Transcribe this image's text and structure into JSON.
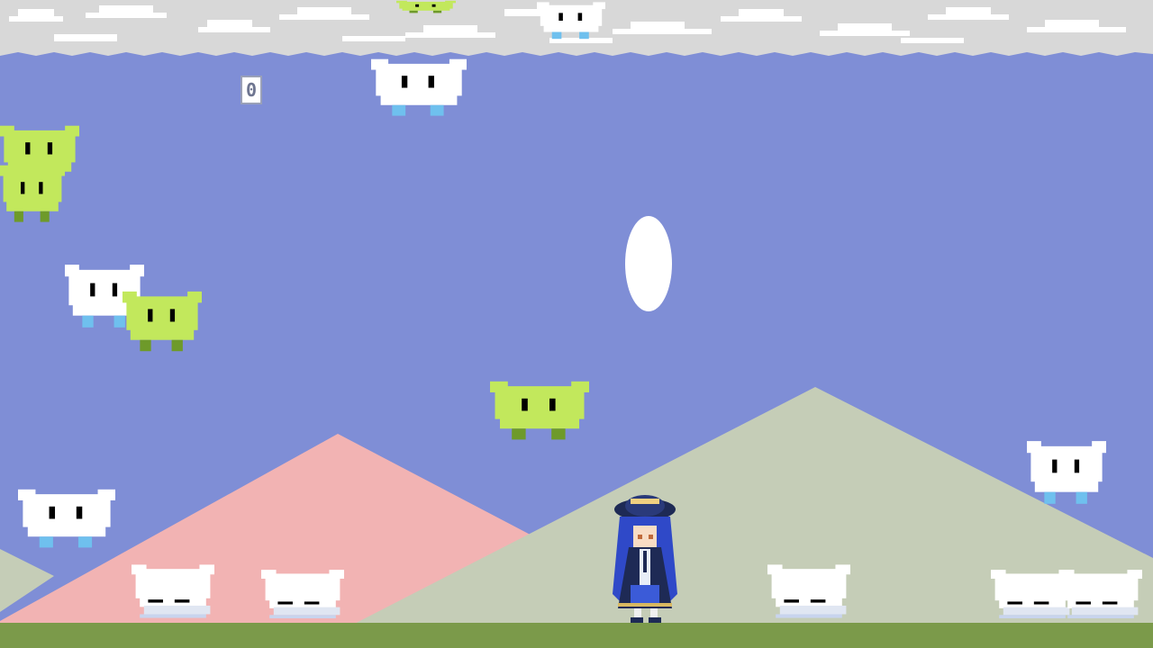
{
  "hud": {
    "score": "0"
  },
  "colors": {
    "sky": "#7f8ed6",
    "cloud_band": "#d8d8d8",
    "cloud": "#ffffff",
    "mountain_pink": "#f2b3b3",
    "mountain_sage": "#c5cdb7",
    "ground": "#7b9a4a",
    "blob_white": "#ffffff",
    "blob_green": "#c2e85c",
    "feet_white": "#6fc0ee",
    "feet_green": "#6e9a2a",
    "eye": "#000000",
    "character_hair": "#2f49c8",
    "character_coat": "#1e2a55"
  },
  "scene": {
    "blobs": [
      {
        "kind": "white-flying",
        "color": "white"
      },
      {
        "kind": "green-flying",
        "color": "green"
      },
      {
        "kind": "white-flying",
        "color": "white"
      },
      {
        "kind": "green-flying",
        "color": "green"
      },
      {
        "kind": "green-flying",
        "color": "green"
      },
      {
        "kind": "white-flying",
        "color": "white"
      },
      {
        "kind": "green-flying",
        "color": "green"
      },
      {
        "kind": "green-flying",
        "color": "green"
      },
      {
        "kind": "white-flying",
        "color": "white"
      },
      {
        "kind": "white-flying",
        "color": "white"
      },
      {
        "kind": "white-sleeping",
        "color": "white"
      },
      {
        "kind": "white-sleeping",
        "color": "white"
      },
      {
        "kind": "white-sleeping",
        "color": "white"
      },
      {
        "kind": "white-sleeping",
        "color": "white"
      },
      {
        "kind": "white-sleeping",
        "color": "white"
      }
    ],
    "projectile": {
      "kind": "white-oval"
    },
    "player": {
      "name": "witch-player",
      "icon": "player-character"
    }
  }
}
